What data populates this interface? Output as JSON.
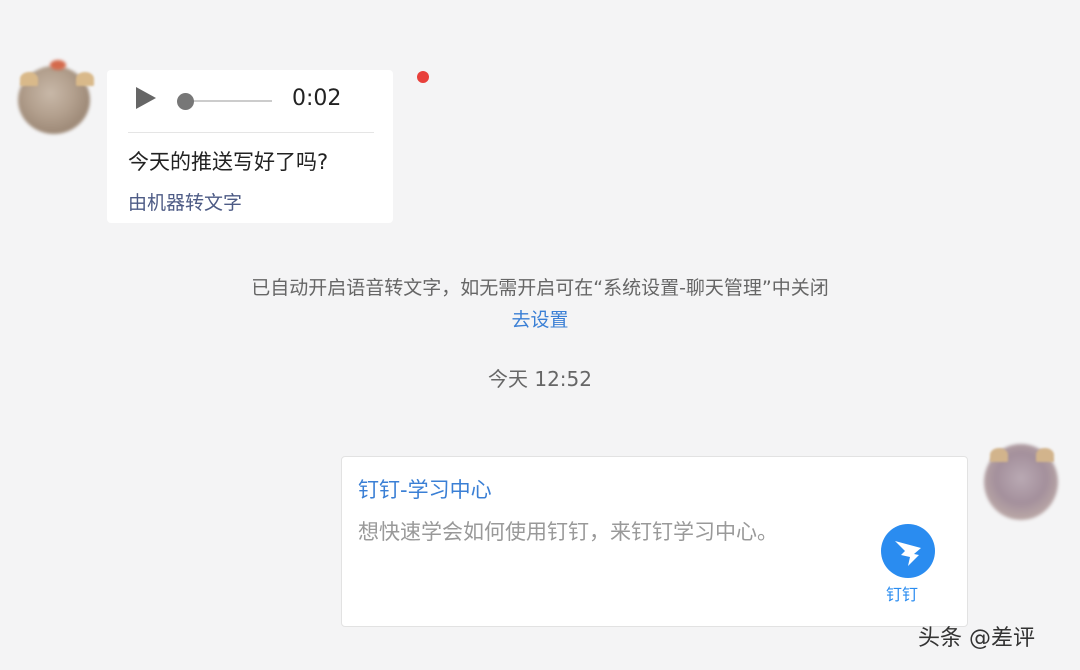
{
  "incoming_voice": {
    "duration": "0:02",
    "transcript": "今天的推送写好了吗?",
    "conversion_label": "由机器转文字"
  },
  "system_notice": {
    "message": "已自动开启语音转文字，如无需开启可在“系统设置-聊天管理”中关闭",
    "link_label": "去设置"
  },
  "timestamp": "今天 12:52",
  "outgoing_card": {
    "title": "钉钉-学习中心",
    "description": "想快速学会如何使用钉钉，来钉钉学习中心。",
    "logo_icon": "dingtalk-icon",
    "logo_label": "钉钉"
  },
  "watermark": "头条 @差评",
  "colors": {
    "background": "#f4f4f5",
    "link_blue": "#3a7fd5",
    "unread_red": "#e8403b",
    "brand_blue": "#2a8cf0"
  }
}
